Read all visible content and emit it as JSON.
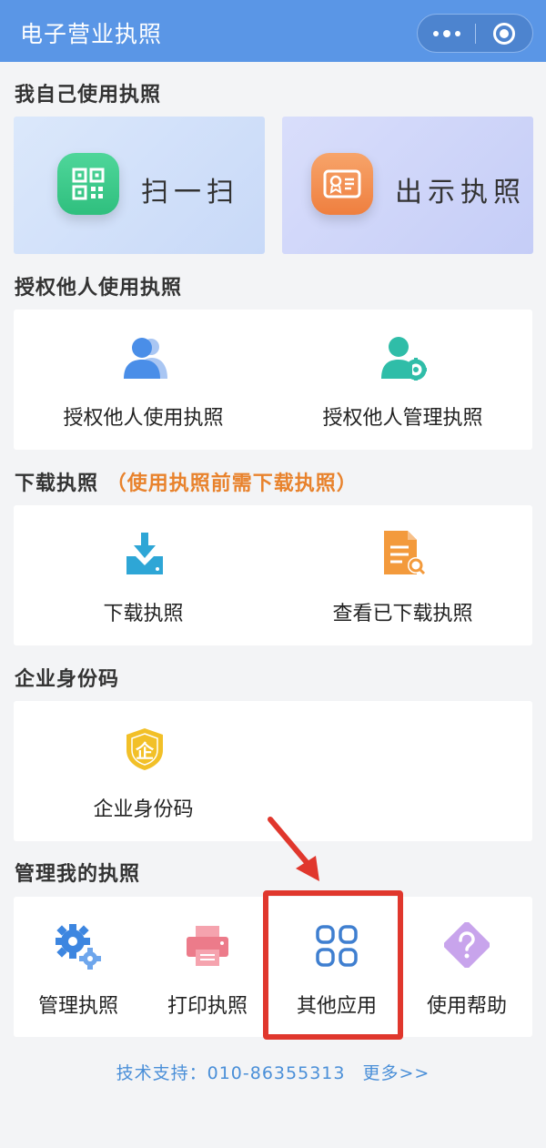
{
  "header": {
    "title": "电子营业执照"
  },
  "sections": {
    "self": {
      "title": "我自己使用执照",
      "scan_label": "扫一扫",
      "show_label": "出示执照"
    },
    "authorize": {
      "title": "授权他人使用执照",
      "use_label": "授权他人使用执照",
      "manage_label": "授权他人管理执照"
    },
    "download": {
      "title": "下载执照",
      "note": "（使用执照前需下载执照）",
      "download_label": "下载执照",
      "view_label": "查看已下载执照"
    },
    "enterprise": {
      "title": "企业身份码",
      "code_label": "企业身份码",
      "badge_char": "企"
    },
    "manage": {
      "title": "管理我的执照",
      "manage_label": "管理执照",
      "print_label": "打印执照",
      "other_label": "其他应用",
      "help_label": "使用帮助"
    }
  },
  "footer": {
    "support": "技术支持：010-86355313",
    "more": "更多>>"
  },
  "colors": {
    "header": "#5a96e6",
    "accent_orange": "#e8822c",
    "highlight": "#e0372d",
    "footer_link": "#4a8fd8"
  }
}
